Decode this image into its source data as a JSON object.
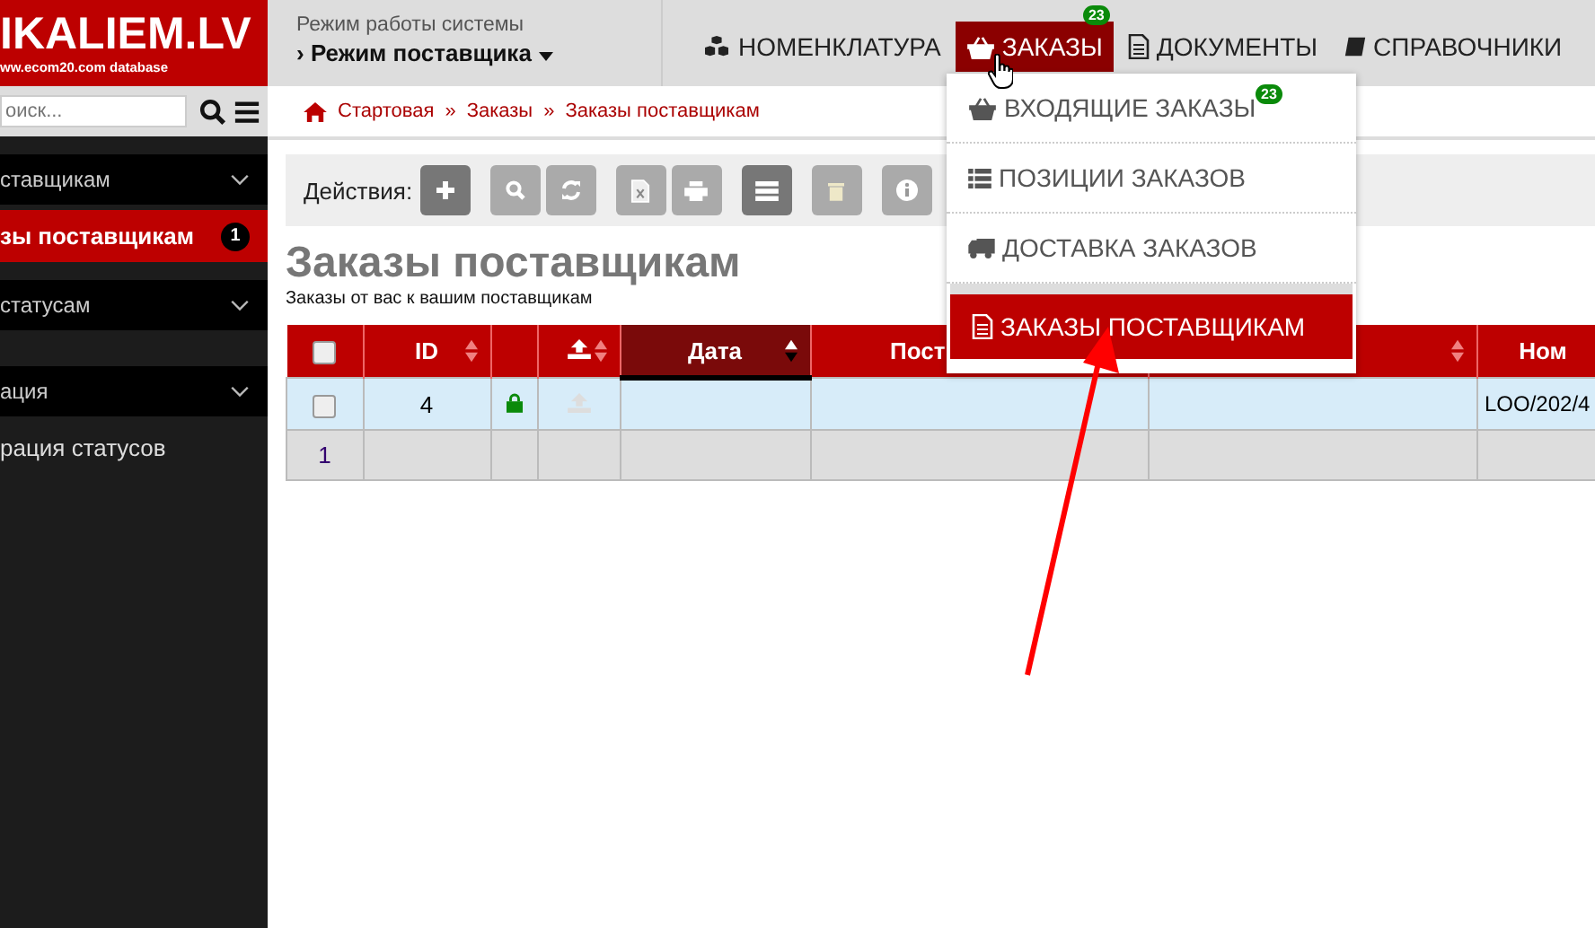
{
  "logo": {
    "title": "IKALIEM.LV",
    "subtitle": "ww.ecom20.com database"
  },
  "mode": {
    "label": "Режим работы системы",
    "value": "› Режим поставщика"
  },
  "nav": [
    {
      "label": "НОМЕНКЛАТУРА",
      "selected": false
    },
    {
      "label": "ЗАКАЗЫ",
      "selected": true,
      "badge": "23"
    },
    {
      "label": "ДОКУМЕНТЫ",
      "selected": false
    },
    {
      "label": "СПРАВОЧНИКИ",
      "selected": false
    }
  ],
  "dropdown": [
    {
      "label": "ВХОДЯЩИЕ ЗАКАЗЫ",
      "badge": "23",
      "selected": false
    },
    {
      "label": "ПОЗИЦИИ ЗАКАЗОВ",
      "selected": false
    },
    {
      "label": "ДОСТАВКА ЗАКАЗОВ",
      "selected": false
    },
    {
      "label": "ЗАКАЗЫ ПОСТАВЩИКАМ",
      "selected": true
    }
  ],
  "search": {
    "placeholder": "оиск..."
  },
  "sidebar": {
    "items": [
      {
        "kind": "group",
        "label": "ставщикам",
        "selected": false
      },
      {
        "kind": "item",
        "label": "зы поставщикам",
        "badge": "1",
        "selected": true
      },
      {
        "kind": "group",
        "label": "статусам",
        "selected": false
      },
      {
        "kind": "group",
        "label": "ация",
        "selected": false
      },
      {
        "kind": "link",
        "label": "рация статусов",
        "selected": false
      }
    ]
  },
  "breadcrumb": [
    {
      "label": "Стартовая"
    },
    {
      "sep": "»",
      "label": "Заказы"
    },
    {
      "sep": "»",
      "label": "Заказы поставщикам"
    }
  ],
  "toolbar": {
    "label": "Действия:"
  },
  "page": {
    "title": "Заказы поставщикам",
    "subtitle": "Заказы от вас к вашим поставщикам"
  },
  "table": {
    "columns": [
      {
        "kind": "check",
        "checked": false
      },
      {
        "kind": "text",
        "label": "ID",
        "sortable": true
      },
      {
        "kind": "text",
        "sortable": false
      },
      {
        "kind": "upload",
        "sortable": true
      },
      {
        "kind": "text",
        "label": "Дата",
        "sortable": true,
        "selected": true
      },
      {
        "kind": "text",
        "label": "Пост",
        "sortable": false
      },
      {
        "kind": "text",
        "sortable": true
      },
      {
        "kind": "text",
        "label": "Ном"
      }
    ],
    "rows": [
      {
        "kind": "data",
        "checked": false,
        "id": "4",
        "locked": true,
        "number": "LOO/202/4"
      },
      {
        "kind": "pager",
        "page": "1"
      }
    ]
  }
}
